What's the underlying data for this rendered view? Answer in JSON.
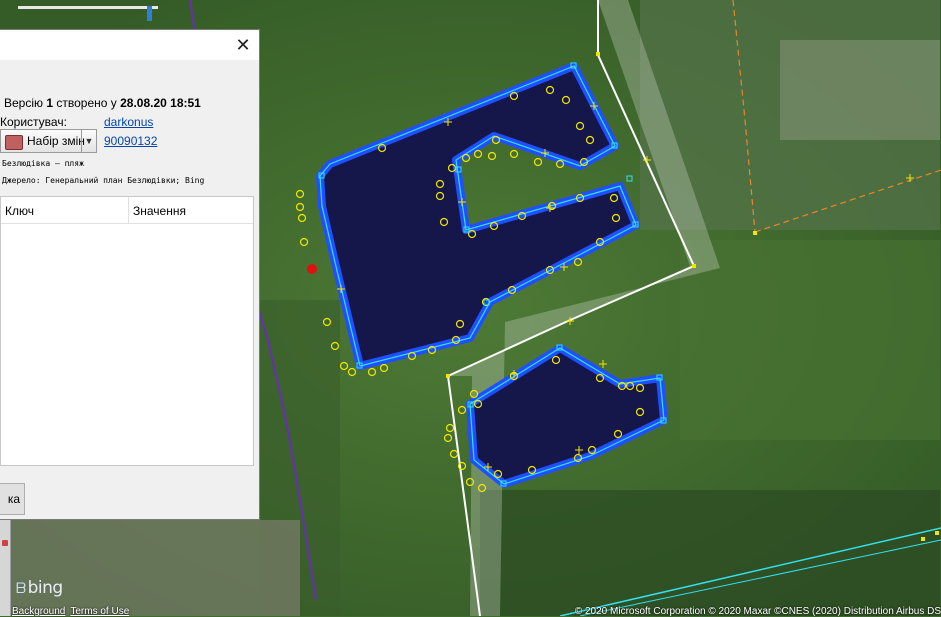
{
  "dialog": {
    "close_label": "✕",
    "version_prefix": "Версію ",
    "version_number": "1",
    "version_mid": " створено у ",
    "version_date": "28.08.20 18:51",
    "user_label": "Користувач:",
    "user_name": "darkonus",
    "changeset_button_label": "Набір змін",
    "changeset_id": "90090132",
    "comment": "Безлюдівка — пляж",
    "source": "Джерело: Генеральний план Безлюдівки; Bing",
    "tag_table": {
      "col_key": "Ключ",
      "col_value": "Значення"
    },
    "bottom_button_label": "ка"
  },
  "map": {
    "bing_logo": "bing",
    "links": [
      "Background",
      "Terms of Use"
    ],
    "attribution": "© 2020 Microsoft Corporation © 2020 Maxar ©CNES (2020) Distribution Airbus DS"
  },
  "colors": {
    "water": "#15174a",
    "outline": "#33e0ee",
    "way": "#1f4fff",
    "node": "#f2e600",
    "road": "#ffffff",
    "boundary": "#e8862a",
    "river": "#6a2db8"
  }
}
